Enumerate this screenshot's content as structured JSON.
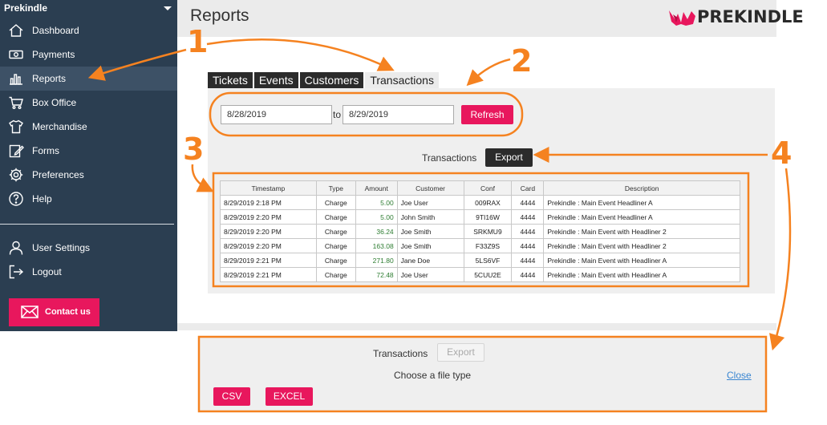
{
  "sidebar": {
    "brand": "Prekindle",
    "items": [
      {
        "label": "Dashboard",
        "icon": "home-icon"
      },
      {
        "label": "Payments",
        "icon": "money-icon"
      },
      {
        "label": "Reports",
        "icon": "bar-chart-icon"
      },
      {
        "label": "Box Office",
        "icon": "cart-icon"
      },
      {
        "label": "Merchandise",
        "icon": "shirt-icon"
      },
      {
        "label": "Forms",
        "icon": "edit-form-icon"
      },
      {
        "label": "Preferences",
        "icon": "gear-icon"
      },
      {
        "label": "Help",
        "icon": "help-icon"
      }
    ],
    "account": [
      {
        "label": "User Settings",
        "icon": "user-icon"
      },
      {
        "label": "Logout",
        "icon": "logout-icon"
      }
    ],
    "contact": "Contact us",
    "active_item": "Reports"
  },
  "header": {
    "title": "Reports",
    "logo_text": "PREKINDLE"
  },
  "tabs": [
    "Tickets",
    "Events",
    "Customers",
    "Transactions"
  ],
  "active_tab": "Transactions",
  "filter": {
    "from_date": "8/28/2019",
    "to_label": "to",
    "to_date": "8/29/2019",
    "refresh": "Refresh"
  },
  "transactions_label": "Transactions",
  "export_label": "Export",
  "table": {
    "columns": [
      "Timestamp",
      "Type",
      "Amount",
      "Customer",
      "Conf",
      "Card",
      "Description"
    ],
    "rows": [
      [
        "8/29/2019 2:18 PM",
        "Charge",
        "5.00",
        "Joe User",
        "009RAX",
        "4444",
        "Prekindle : Main Event Headliner A"
      ],
      [
        "8/29/2019 2:20 PM",
        "Charge",
        "5.00",
        "John Smith",
        "9TI16W",
        "4444",
        "Prekindle : Main Event Headliner A"
      ],
      [
        "8/29/2019 2:20 PM",
        "Charge",
        "36.24",
        "Joe Smith",
        "SRKMU9",
        "4444",
        "Prekindle : Main Event with Headliner 2"
      ],
      [
        "8/29/2019 2:20 PM",
        "Charge",
        "163.08",
        "Joe Smith",
        "F33Z9S",
        "4444",
        "Prekindle : Main Event with Headliner 2"
      ],
      [
        "8/29/2019 2:21 PM",
        "Charge",
        "271.80",
        "Jane Doe",
        "5LS6VF",
        "4444",
        "Prekindle : Main Event with Headliner A"
      ],
      [
        "8/29/2019 2:21 PM",
        "Charge",
        "72.48",
        "Joe User",
        "5CUU2E",
        "4444",
        "Prekindle : Main Event with Headliner A"
      ]
    ]
  },
  "export_modal": {
    "transactions_label": "Transactions",
    "export_label": "Export",
    "choose": "Choose a file type",
    "close": "Close",
    "csv": "CSV",
    "excel": "EXCEL"
  },
  "annotations": [
    "1",
    "2",
    "3",
    "4"
  ],
  "colors": {
    "sidebar": "#2b3e51",
    "accent": "#e8175d",
    "annotation": "#f58220"
  }
}
